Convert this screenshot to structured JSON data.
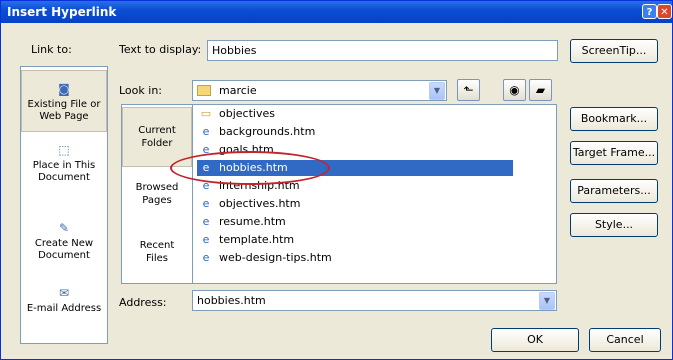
{
  "window": {
    "title": "Insert Hyperlink",
    "help_glyph": "?",
    "close_glyph": "✕"
  },
  "link_to": {
    "label": "Link to:",
    "items": [
      {
        "label": "Existing File or Web Page",
        "icon": "web-page-icon",
        "glyph": "◙"
      },
      {
        "label": "Place in This Document",
        "icon": "document-place-icon",
        "glyph": "⬚"
      },
      {
        "label": "Create New Document",
        "icon": "new-document-icon",
        "glyph": "✎"
      },
      {
        "label": "E-mail Address",
        "icon": "email-icon",
        "glyph": "✉"
      }
    ]
  },
  "text_to_display": {
    "label": "Text to display:",
    "value": "Hobbies"
  },
  "look_in": {
    "label": "Look in:",
    "value": "marcie"
  },
  "tabs": [
    {
      "label": "Current Folder"
    },
    {
      "label": "Browsed Pages"
    },
    {
      "label": "Recent Files"
    }
  ],
  "files": [
    {
      "name": "objectives",
      "type": "folder",
      "glyph": "▭"
    },
    {
      "name": "backgrounds.htm",
      "type": "htm",
      "glyph": "e"
    },
    {
      "name": "goals.htm",
      "type": "htm",
      "glyph": "e"
    },
    {
      "name": "hobbies.htm",
      "type": "htm",
      "glyph": "e"
    },
    {
      "name": "internship.htm",
      "type": "htm",
      "glyph": "e"
    },
    {
      "name": "objectives.htm",
      "type": "htm",
      "glyph": "e"
    },
    {
      "name": "resume.htm",
      "type": "htm",
      "glyph": "e"
    },
    {
      "name": "template.htm",
      "type": "htm",
      "glyph": "e"
    },
    {
      "name": "web-design-tips.htm",
      "type": "htm",
      "glyph": "e"
    }
  ],
  "address": {
    "label": "Address:",
    "value": "hobbies.htm"
  },
  "buttons": {
    "screentip": "ScreenTip...",
    "bookmark": "Bookmark...",
    "target_frame": "Target Frame...",
    "parameters": "Parameters...",
    "style": "Style...",
    "ok": "OK",
    "cancel": "Cancel"
  },
  "toolbar_glyphs": {
    "up_folder": "⬑",
    "browse_web": "◉",
    "browse_file": "▰",
    "dropdown": "▼",
    "scroll_up": "▲",
    "scroll_down": "▼"
  },
  "colors": {
    "selection": "#316ac5",
    "annotation": "#c0262b",
    "title_bar": "#0a4fd4"
  }
}
